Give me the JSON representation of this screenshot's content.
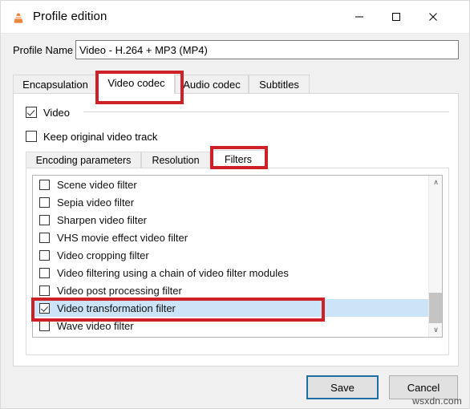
{
  "window": {
    "title": "Profile edition",
    "app_icon": "vlc-cone-icon",
    "controls": {
      "minimize": "–",
      "maximize": "□",
      "close": "✕"
    }
  },
  "profile": {
    "label": "Profile Name",
    "value": "Video - H.264 + MP3 (MP4)",
    "placeholder": "Profile Name"
  },
  "tabs": [
    {
      "label": "Encapsulation",
      "active": false
    },
    {
      "label": "Video codec",
      "active": true
    },
    {
      "label": "Audio codec",
      "active": false
    },
    {
      "label": "Subtitles",
      "active": false
    }
  ],
  "video_panel": {
    "video_checkbox": {
      "label": "Video",
      "checked": true
    },
    "keep_track_checkbox": {
      "label": "Keep original video track",
      "checked": false
    }
  },
  "subtabs": [
    {
      "label": "Encoding parameters",
      "active": false
    },
    {
      "label": "Resolution",
      "active": false
    },
    {
      "label": "Filters",
      "active": true
    }
  ],
  "filters": [
    {
      "label": "Scene video filter",
      "checked": false,
      "selected": false
    },
    {
      "label": "Sepia video filter",
      "checked": false,
      "selected": false
    },
    {
      "label": "Sharpen video filter",
      "checked": false,
      "selected": false
    },
    {
      "label": "VHS movie effect video filter",
      "checked": false,
      "selected": false
    },
    {
      "label": "Video cropping filter",
      "checked": false,
      "selected": false
    },
    {
      "label": "Video filtering using a chain of video filter modules",
      "checked": false,
      "selected": false
    },
    {
      "label": "Video post processing filter",
      "checked": false,
      "selected": false
    },
    {
      "label": "Video transformation filter",
      "checked": true,
      "selected": true
    },
    {
      "label": "Wave video filter",
      "checked": false,
      "selected": false
    }
  ],
  "scrollbar": {
    "up_arrow": "∧",
    "down_arrow": "∨"
  },
  "footer": {
    "save_label": "Save",
    "cancel_label": "Cancel"
  },
  "watermark": "wsxdn.com",
  "colors": {
    "annotation_red": "#ce2027",
    "selection_blue": "#cce4f7",
    "focus_border": "#1d6ea3"
  }
}
